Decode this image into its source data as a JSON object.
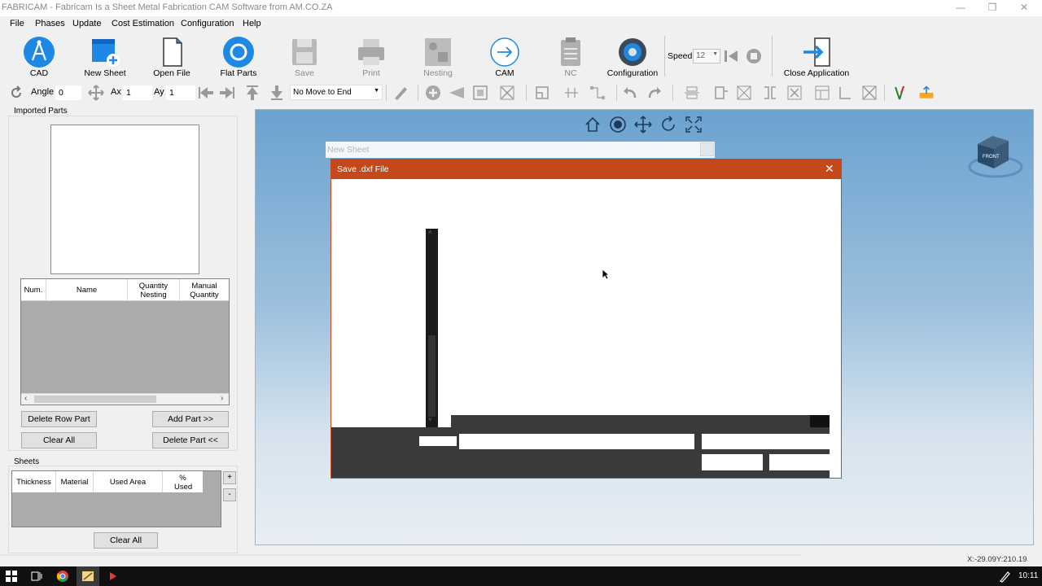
{
  "window": {
    "title": "FABRICAM - Fabricam Is a Sheet Metal Fabrication CAM Software from AM.CO.ZA"
  },
  "menu": [
    "File",
    "Phases",
    "Update",
    "Cost Estimation",
    "Configuration",
    "Help"
  ],
  "ribbon": {
    "cad": "CAD",
    "new_sheet": "New Sheet",
    "open_file": "Open File",
    "flat_parts": "Flat Parts",
    "save": "Save",
    "print": "Print",
    "nesting": "Nesting",
    "cam": "CAM",
    "nc": "NC",
    "configuration": "Configuration",
    "speed_label": "Speed",
    "speed_value": "12",
    "close_app": "Close Application"
  },
  "toolbar": {
    "angle_label": "Angle",
    "angle_value": "0",
    "ax_label": "Ax",
    "ax_value": "1",
    "ay_label": "Ay",
    "ay_value": "1",
    "move_option": "No Move to End"
  },
  "left_panel": {
    "imported_parts": "Imported Parts",
    "parts_columns": [
      "Num.",
      "Name",
      "Quantity Nesting",
      "Manual Quantity"
    ],
    "delete_row_part": "Delete Row Part",
    "add_part": "Add Part >>",
    "clear_all": "Clear All",
    "delete_part": "Delete Part <<",
    "sheets_label": "Sheets",
    "sheets_columns": [
      "Thickness",
      "Material",
      "Used Area",
      "% Used"
    ],
    "plus": "+",
    "minus": "-",
    "sheets_clear_all": "Clear All"
  },
  "viewport": {
    "new_sheet_window": "New Sheet",
    "cube_label": "FRONT"
  },
  "dialog": {
    "title": "Save .dxf File"
  },
  "status": {
    "coords": "X:-29.09Y:210.19"
  },
  "taskbar": {
    "time": "10:11"
  },
  "colors": {
    "dialog_accent": "#c4481a",
    "viewport_top": "#6ba2cf",
    "icon_blue": "#1e88e5"
  }
}
